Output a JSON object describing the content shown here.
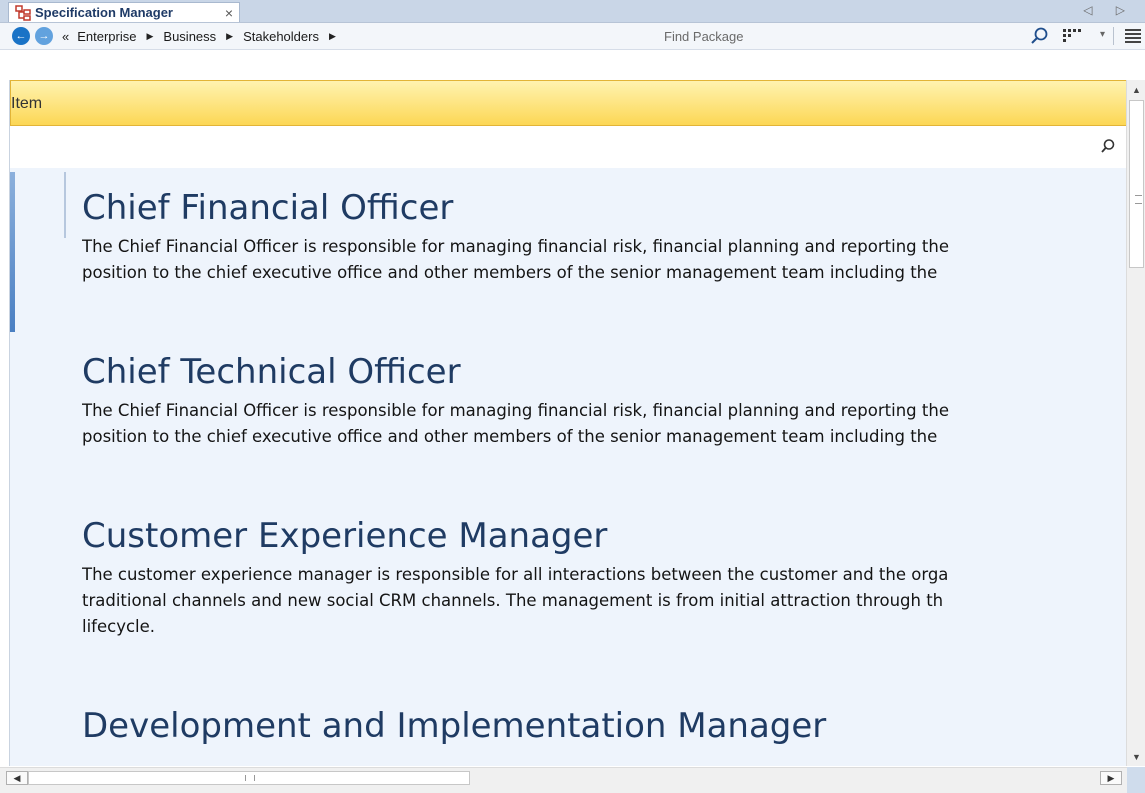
{
  "window": {
    "tab_title": "Specification Manager",
    "tab_close": "×",
    "tab_nav": "◁ ▷"
  },
  "toolbar": {
    "back_icon": "←",
    "forward_icon": "→",
    "chevron": "«",
    "breadcrumbs": [
      "Enterprise",
      "Business",
      "Stakeholders"
    ],
    "find_placeholder": "Find Package",
    "icons": [
      "back-icon",
      "forward-icon",
      "search-icon",
      "view-options-icon",
      "chevron-down-icon",
      "menu-icon"
    ]
  },
  "header": {
    "column": "Item"
  },
  "entries": [
    {
      "title": "Chief Financial Officer",
      "lines": [
        "The Chief Financial Officer is responsible for managing financial risk, financial planning and reporting the",
        "position to the chief executive office and other members of the senior management team including the"
      ]
    },
    {
      "title": "Chief Technical Officer",
      "lines": [
        "The Chief Financial Officer is responsible for managing financial risk, financial planning and reporting the",
        "position to the chief executive office and other members of the senior management team including the"
      ]
    },
    {
      "title": "Customer Experience Manager",
      "lines": [
        "The customer experience manager is responsible for all interactions between the customer and the orga",
        "traditional channels and new social CRM channels. The management is from initial attraction through th",
        "lifecycle."
      ]
    },
    {
      "title": "Development and Implementation Manager",
      "lines": []
    }
  ],
  "colors": {
    "accent": "#1f3b63",
    "header_gradient_top": "#fff3b0",
    "header_gradient_bottom": "#fcd755",
    "content_bg": "#eef4fc"
  }
}
